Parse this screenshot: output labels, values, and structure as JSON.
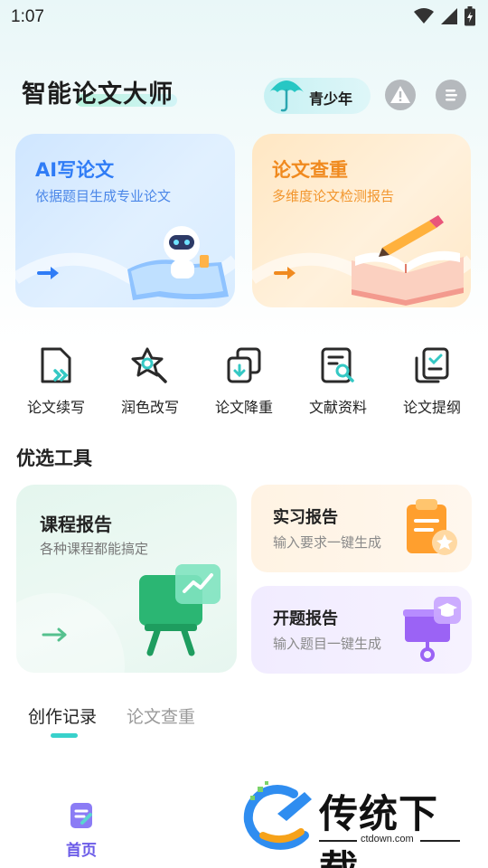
{
  "status_bar": {
    "time": "1:07"
  },
  "header": {
    "title": "智能论文大师",
    "youth_mode_label": "青少年",
    "alert_icon": "exclamation-circle-icon",
    "menu_icon": "menu-lines-icon"
  },
  "feature_cards": [
    {
      "title": "AI写论文",
      "subtitle": "依据题目生成专业论文",
      "icon": "robot-writing-illustration"
    },
    {
      "title": "论文查重",
      "subtitle": "多维度论文检测报告",
      "icon": "book-pencil-illustration"
    }
  ],
  "tools": [
    {
      "label": "论文续写",
      "icon": "document-continue-icon"
    },
    {
      "label": "润色改写",
      "icon": "polish-star-search-icon"
    },
    {
      "label": "论文降重",
      "icon": "copy-download-icon"
    },
    {
      "label": "文献资料",
      "icon": "document-search-icon"
    },
    {
      "label": "论文提纲",
      "icon": "clipboard-check-icon"
    }
  ],
  "featured": {
    "section_title": "优选工具",
    "course_report": {
      "title": "课程报告",
      "subtitle": "各种课程都能搞定"
    },
    "internship_report": {
      "title": "实习报告",
      "subtitle": "输入要求一键生成"
    },
    "proposal_report": {
      "title": "开题报告",
      "subtitle": "输入题目一键生成"
    }
  },
  "record_tabs": [
    {
      "label": "创作记录",
      "active": true
    },
    {
      "label": "论文查重",
      "active": false
    }
  ],
  "bottom_nav": {
    "home_label": "首页"
  },
  "watermark": {
    "text": "传统下载",
    "url": "ctdown.com"
  },
  "colors": {
    "accent_teal": "#38d1cb",
    "nav_active": "#6b5be8",
    "ai_blue": "#2f7cf6",
    "check_orange": "#f08a1f"
  }
}
